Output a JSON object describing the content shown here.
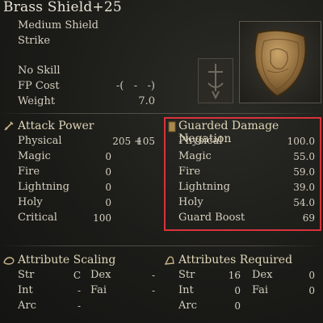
{
  "item": {
    "name": "Brass Shield+25",
    "weapon_type": "Medium Shield",
    "damage_type": "Strike",
    "skill": "No Skill",
    "fp_cost_label": "FP Cost",
    "fp_cost_value": "-(   -   -)",
    "weight_label": "Weight",
    "weight_value": "7.0"
  },
  "attack_power": {
    "title": "Attack Power",
    "rows": [
      {
        "label": "Physical",
        "value": "205 +",
        "extra": "105"
      },
      {
        "label": "Magic",
        "value": "0"
      },
      {
        "label": "Fire",
        "value": "0"
      },
      {
        "label": "Lightning",
        "value": "0"
      },
      {
        "label": "Holy",
        "value": "0"
      },
      {
        "label": "Critical",
        "value": "100"
      }
    ]
  },
  "guarded": {
    "title": "Guarded Damage Negation",
    "rows": [
      {
        "label": "Physical",
        "value": "100.0"
      },
      {
        "label": "Magic",
        "value": "55.0"
      },
      {
        "label": "Fire",
        "value": "59.0"
      },
      {
        "label": "Lightning",
        "value": "39.0"
      },
      {
        "label": "Holy",
        "value": "54.0"
      },
      {
        "label": "Guard Boost",
        "value": "69"
      }
    ]
  },
  "attribute_scaling": {
    "title": "Attribute Scaling",
    "rows": [
      {
        "l1": "Str",
        "v1": "C",
        "l2": "Dex",
        "v2": "-"
      },
      {
        "l1": "Int",
        "v1": "-",
        "l2": "Fai",
        "v2": "-"
      },
      {
        "l1": "Arc",
        "v1": "-"
      }
    ]
  },
  "attributes_required": {
    "title": "Attributes Required",
    "rows": [
      {
        "l1": "Str",
        "v1": "16",
        "l2": "Dex",
        "v2": "0"
      },
      {
        "l1": "Int",
        "v1": "0",
        "l2": "Fai",
        "v2": "0"
      },
      {
        "l1": "Arc",
        "v1": "0"
      }
    ]
  },
  "colors": {
    "highlight": "#d8333a",
    "background": "#1b1b18",
    "text": "#d9d4c4"
  },
  "icons": [
    "sword-icon",
    "shield-badge-icon",
    "scaling-hand-icon",
    "requirements-hand-icon",
    "sword-slot-icon"
  ]
}
